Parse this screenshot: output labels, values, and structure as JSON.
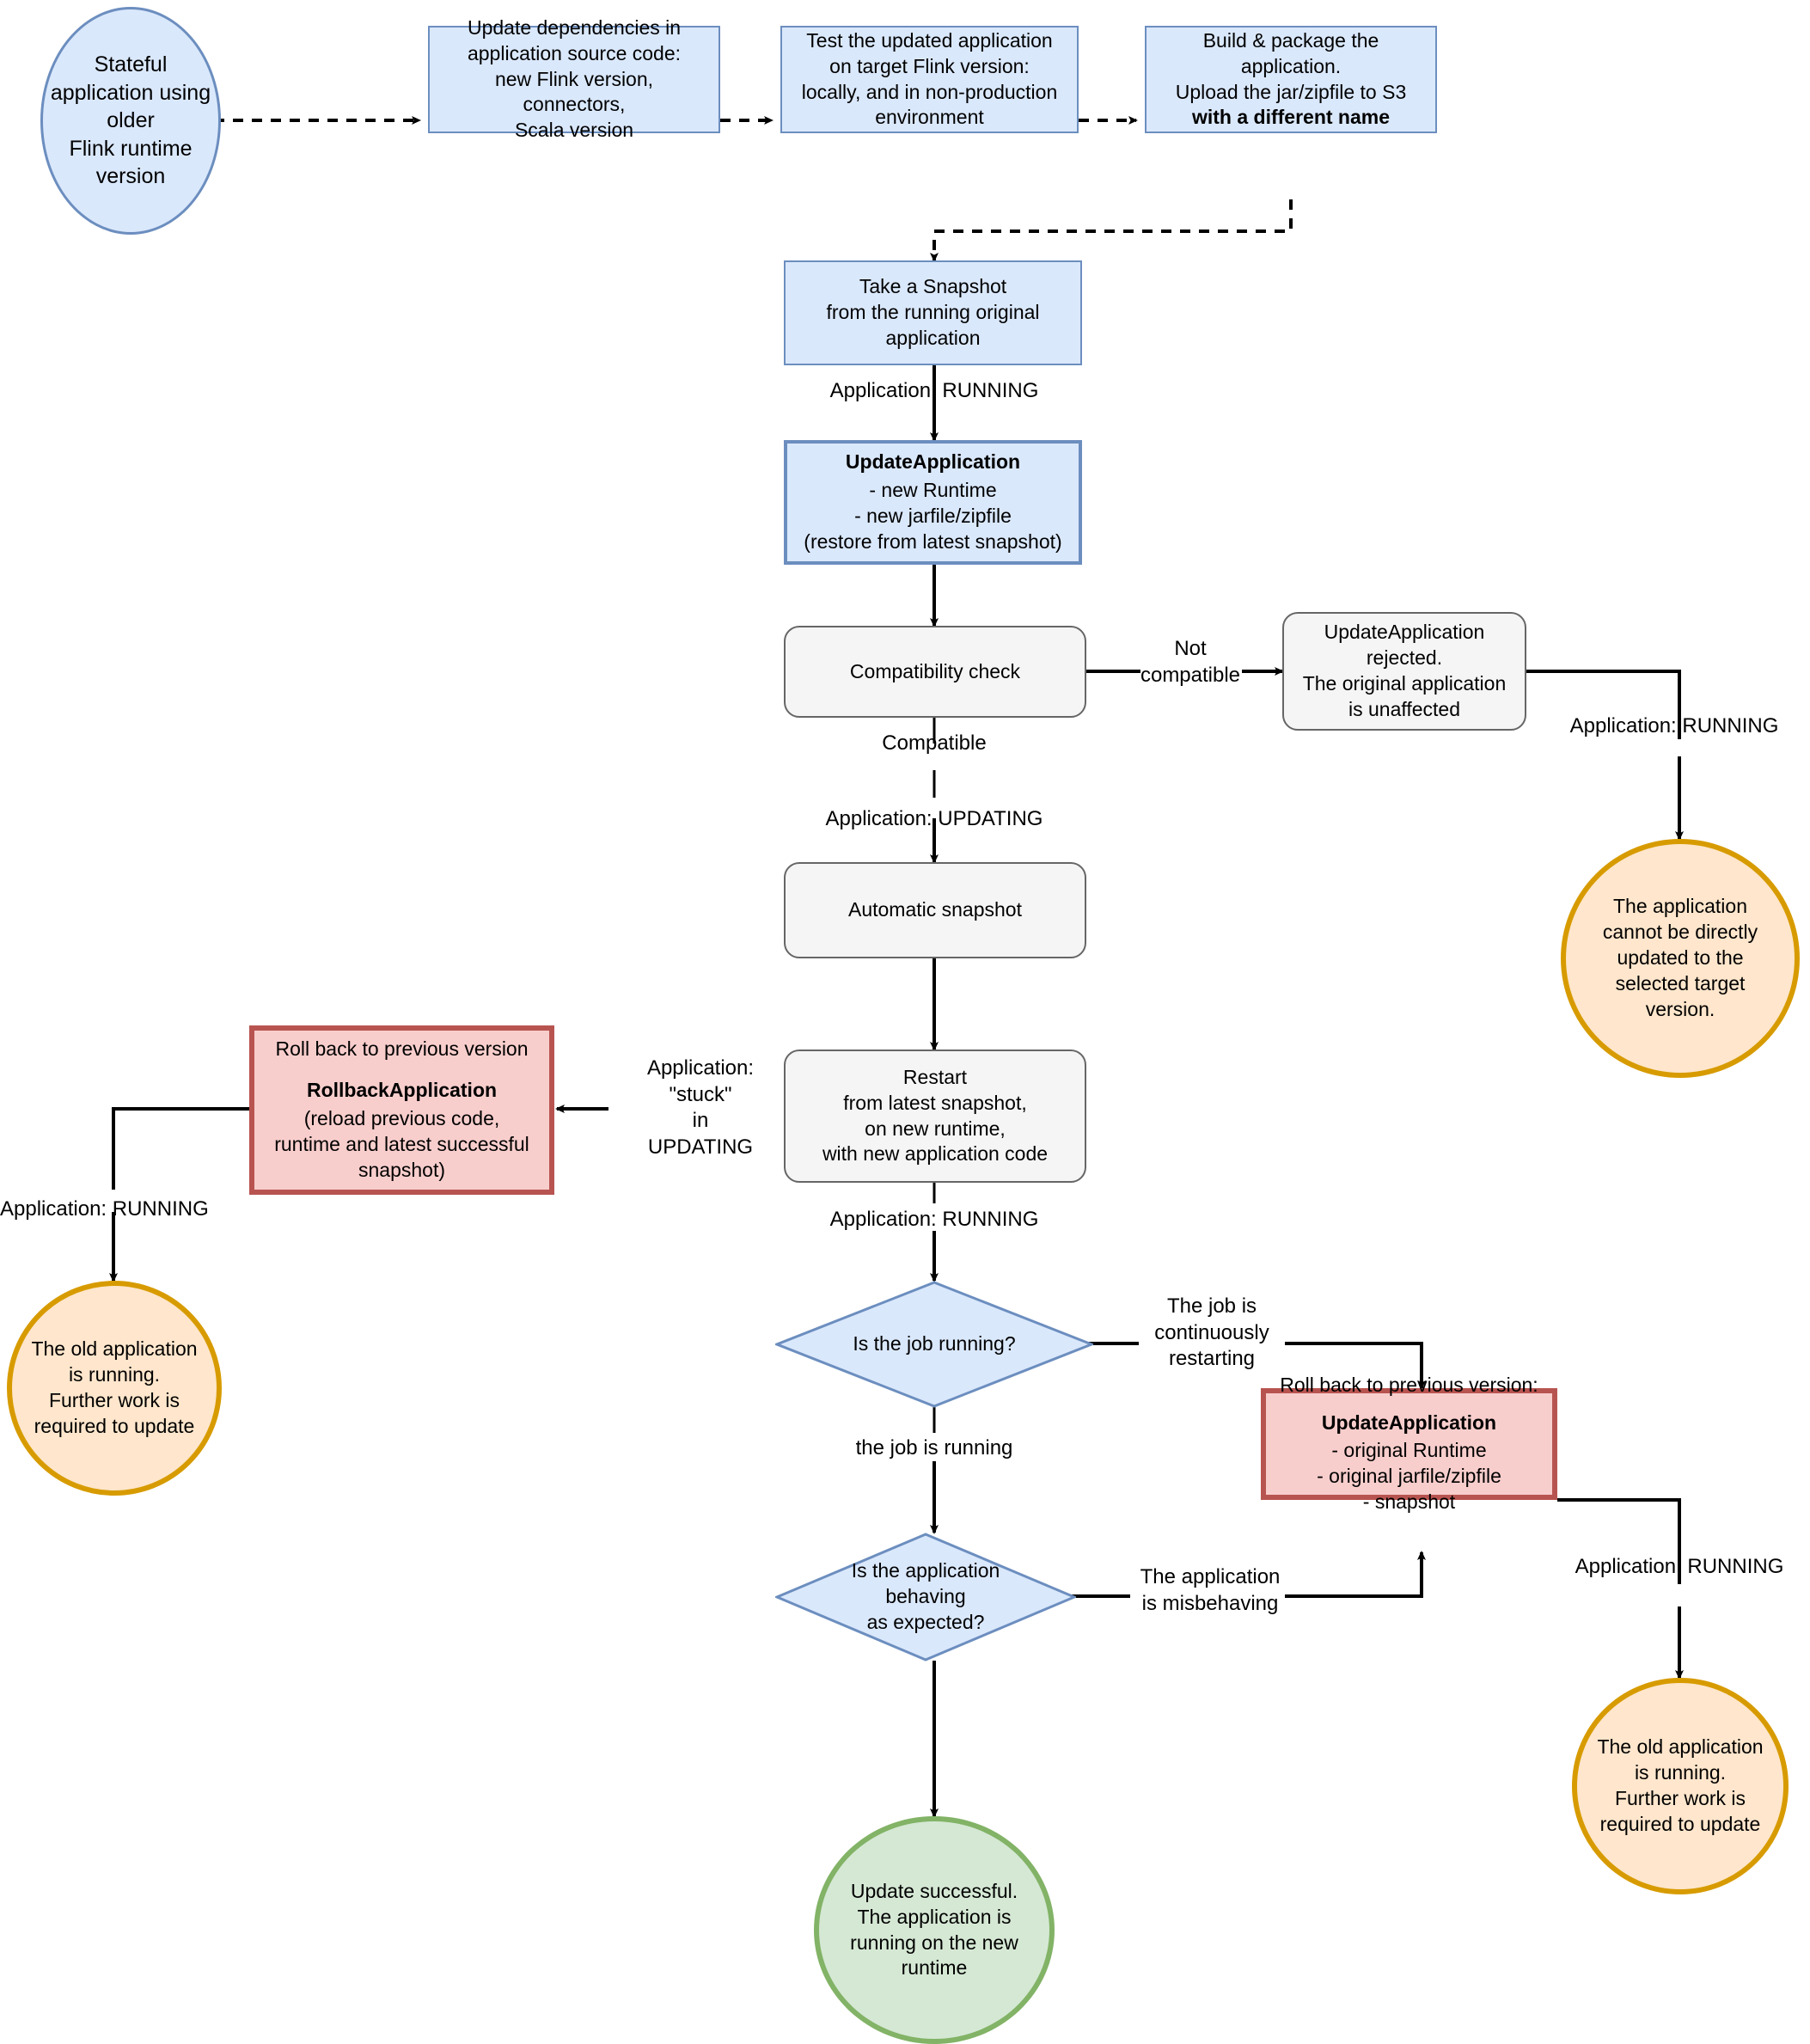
{
  "diagram": {
    "title": "Flink application runtime version upgrade flowchart",
    "colors": {
      "blue_fill": "#dae8fc",
      "blue_stroke": "#6c8ebf",
      "gray_fill": "#f5f5f5",
      "gray_stroke": "#666666",
      "red_fill": "#f8cecc",
      "red_stroke": "#b85450",
      "orange_fill": "#ffe6cc",
      "orange_stroke": "#d79b00",
      "green_fill": "#d5e8d4",
      "green_stroke": "#82b366",
      "edge_stroke": "#000000"
    }
  },
  "nodes": {
    "start_ellipse": "Stateful\napplication using\nolder\nFlink runtime\nversion",
    "update_deps": "Update dependencies in\napplication source code:\nnew Flink version,\nconnectors,\nScala version",
    "test_app": "Test the updated application\non target Flink version:\nlocally, and in non-production\nenvironment",
    "build_package_line1": "Build & package the\napplication.\nUpload the jar/zipfile to S3",
    "build_package_line2": "with a different name",
    "take_snapshot": "Take a Snapshot\nfrom the running original\napplication",
    "update_application_title": "UpdateApplication",
    "update_application_body": "- new Runtime\n- new jarfile/zipfile\n(restore from latest snapshot)",
    "compatibility_check": "Compatibility check",
    "update_rejected": "UpdateApplication\nrejected.\nThe original application\nis unaffected",
    "cannot_update_circle": "The application\ncannot be directly\nupdated to the\nselected target\nversion.",
    "automatic_snapshot": "Automatic snapshot",
    "restart": "Restart\nfrom latest snapshot,\non new runtime,\nwith new application code",
    "rollback_box_header": "Roll back to previous version",
    "rollback_box_title": "RollbackApplication",
    "rollback_box_body": "(reload previous code,\nruntime and latest successful\nsnapshot)",
    "old_app_running_left": "The old application\nis running.\nFurther work is\nrequired to update",
    "is_job_running": "Is the job running?",
    "rollback_right_header": "Roll back to previous version:",
    "rollback_right_title": "UpdateApplication",
    "rollback_right_body": "- original Runtime\n- original jarfile/zipfile\n- snapshot",
    "old_app_running_right": "The old application\nis running.\nFurther work is\nrequired to update",
    "is_app_behaving": "Is the application\nbehaving\nas expected?",
    "update_successful": "Update successful.\nThe application is\nrunning on the new\nruntime"
  },
  "edge_labels": {
    "app_running_after_snapshot": "Application: RUNNING",
    "not_compatible": "Not\ncompatible",
    "compatible": "Compatible",
    "app_updating": "Application: UPDATING",
    "app_running_rejected_branch": "Application: RUNNING",
    "app_stuck_in_updating": "Application:\n\"stuck\"\nin\nUPDATING",
    "app_running_rollback_left": "Application: RUNNING",
    "app_running_after_restart": "Application: RUNNING",
    "job_continuously_restarting": "The job is\ncontinuously\nrestarting",
    "the_job_is_running": "the job is running",
    "app_misbehaving": "The application\nis misbehaving",
    "app_running_rollback_right": "Application: RUNNING"
  }
}
